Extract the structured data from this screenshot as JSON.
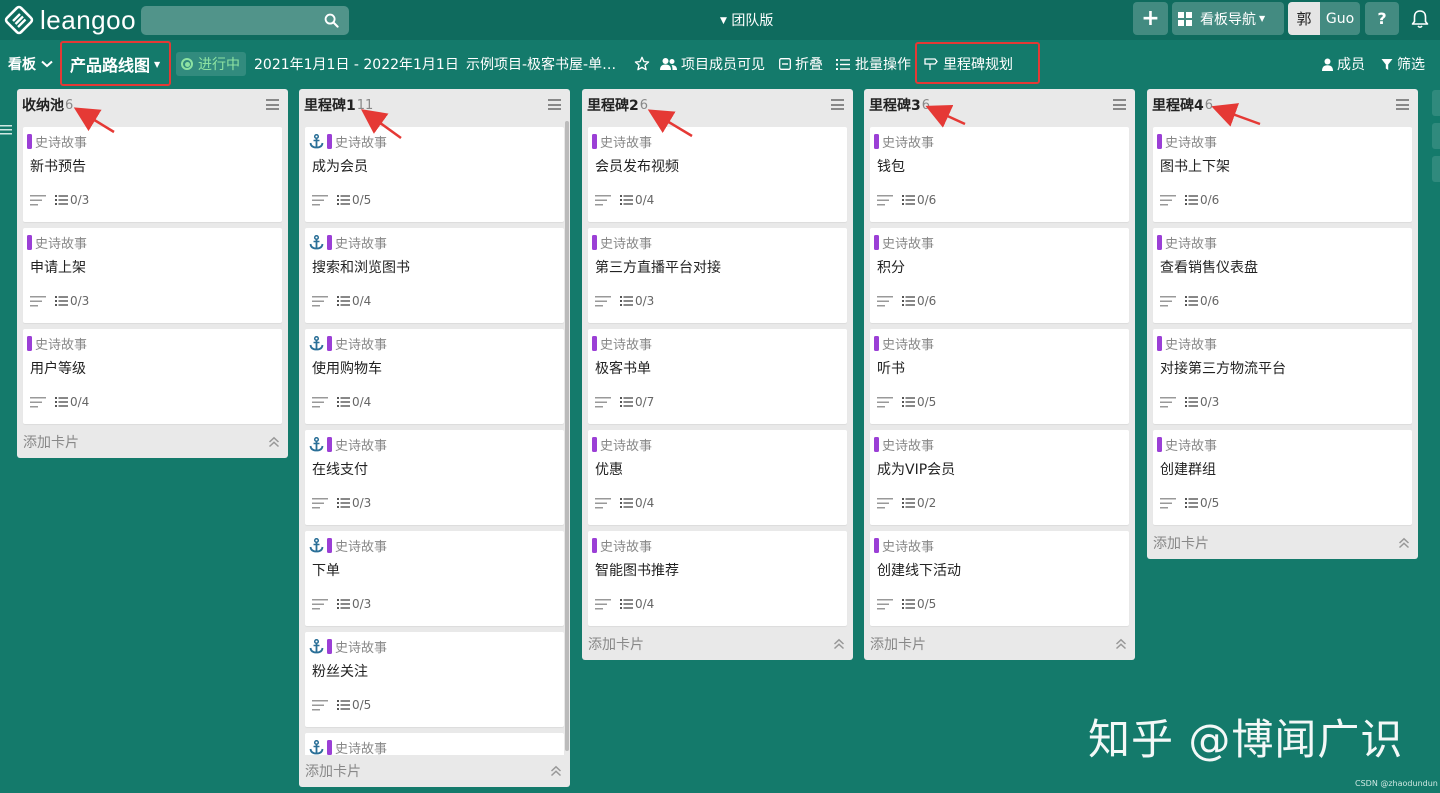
{
  "app": {
    "name": "leangoo",
    "edition": "团队版"
  },
  "search": {
    "placeholder": "",
    "value": ""
  },
  "toolbar": {
    "add": "+",
    "board_nav": "看板导航",
    "user_avatar": "郭",
    "user_name": "Guo",
    "help": "?"
  },
  "board": {
    "view_label": "看板",
    "board_name": "产品路线图",
    "status": "进行中",
    "date_range": "2021年1月1日 - 2022年1月1日",
    "project": "示例项目-极客书屋-单…",
    "visibility": "项目成员可见",
    "fold": "折叠",
    "batch": "批量操作",
    "milestone_plan": "里程碑规划",
    "members": "成员",
    "filter": "筛选"
  },
  "colors": {
    "background": "#147a6b",
    "topbar": "#0f6b5e",
    "tag": "#9b3fd6",
    "anchor": "#2a6f97",
    "highlight": "#e53935"
  },
  "add_card_label": "添加卡片",
  "columns": [
    {
      "title": "收纳池",
      "count": "6",
      "cards": [
        {
          "tag": "史诗故事",
          "anchor": false,
          "title": "新书预告",
          "checklist": "0/3"
        },
        {
          "tag": "史诗故事",
          "anchor": false,
          "title": "申请上架",
          "checklist": "0/3"
        },
        {
          "tag": "史诗故事",
          "anchor": false,
          "title": "用户等级",
          "checklist": "0/4"
        }
      ]
    },
    {
      "title": "里程碑1",
      "count": "11",
      "cards": [
        {
          "tag": "史诗故事",
          "anchor": true,
          "title": "成为会员",
          "checklist": "0/5"
        },
        {
          "tag": "史诗故事",
          "anchor": true,
          "title": "搜索和浏览图书",
          "checklist": "0/4"
        },
        {
          "tag": "史诗故事",
          "anchor": true,
          "title": "使用购物车",
          "checklist": "0/4"
        },
        {
          "tag": "史诗故事",
          "anchor": true,
          "title": "在线支付",
          "checklist": "0/3"
        },
        {
          "tag": "史诗故事",
          "anchor": true,
          "title": "下单",
          "checklist": "0/3"
        },
        {
          "tag": "史诗故事",
          "anchor": true,
          "title": "粉丝关注",
          "checklist": "0/5"
        },
        {
          "tag": "史诗故事",
          "anchor": true,
          "title": "",
          "checklist": ""
        }
      ]
    },
    {
      "title": "里程碑2",
      "count": "6",
      "cards": [
        {
          "tag": "史诗故事",
          "anchor": false,
          "title": "会员发布视频",
          "checklist": "0/4"
        },
        {
          "tag": "史诗故事",
          "anchor": false,
          "title": "第三方直播平台对接",
          "checklist": "0/3"
        },
        {
          "tag": "史诗故事",
          "anchor": false,
          "title": "极客书单",
          "checklist": "0/7"
        },
        {
          "tag": "史诗故事",
          "anchor": false,
          "title": "优惠",
          "checklist": "0/4"
        },
        {
          "tag": "史诗故事",
          "anchor": false,
          "title": "智能图书推荐",
          "checklist": "0/4"
        }
      ]
    },
    {
      "title": "里程碑3",
      "count": "6",
      "cards": [
        {
          "tag": "史诗故事",
          "anchor": false,
          "title": "钱包",
          "checklist": "0/6"
        },
        {
          "tag": "史诗故事",
          "anchor": false,
          "title": "积分",
          "checklist": "0/6"
        },
        {
          "tag": "史诗故事",
          "anchor": false,
          "title": "听书",
          "checklist": "0/5"
        },
        {
          "tag": "史诗故事",
          "anchor": false,
          "title": "成为VIP会员",
          "checklist": "0/2"
        },
        {
          "tag": "史诗故事",
          "anchor": false,
          "title": "创建线下活动",
          "checklist": "0/5"
        }
      ]
    },
    {
      "title": "里程碑4",
      "count": "6",
      "cards": [
        {
          "tag": "史诗故事",
          "anchor": false,
          "title": "图书上下架",
          "checklist": "0/6"
        },
        {
          "tag": "史诗故事",
          "anchor": false,
          "title": "查看销售仪表盘",
          "checklist": "0/6"
        },
        {
          "tag": "史诗故事",
          "anchor": false,
          "title": "对接第三方物流平台",
          "checklist": "0/3"
        },
        {
          "tag": "史诗故事",
          "anchor": false,
          "title": "创建群组",
          "checklist": "0/5"
        }
      ]
    }
  ],
  "watermark": "知乎 @博闻广识",
  "credit": "CSDN @zhaodundun"
}
